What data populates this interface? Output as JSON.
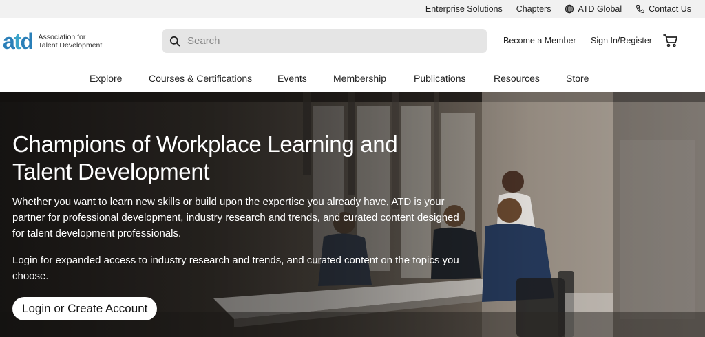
{
  "topbar": {
    "links": {
      "enterprise": "Enterprise Solutions",
      "chapters": "Chapters",
      "global": "ATD Global",
      "contact": "Contact Us"
    }
  },
  "header": {
    "logo": {
      "mark_a": "a",
      "mark_t": "t",
      "mark_d": "d",
      "line1": "Association for",
      "line2": "Talent Development"
    },
    "search": {
      "placeholder": "Search",
      "value": ""
    },
    "become_member": "Become a Member",
    "sign_in": "Sign In/Register"
  },
  "nav": {
    "items": [
      "Explore",
      "Courses & Certifications",
      "Events",
      "Membership",
      "Publications",
      "Resources",
      "Store"
    ]
  },
  "hero": {
    "title": "Champions of Workplace Learning and Talent Development",
    "paragraph1": "Whether you want to learn new skills or build upon the expertise you already have, ATD is your partner for professional development, industry research and trends, and curated content designed for talent development professionals.",
    "paragraph2": "Login for expanded access to industry research and trends, and curated content on the topics you choose.",
    "cta": "Login or Create Account"
  },
  "colors": {
    "brand_blue": "#2a7fb8",
    "brand_teal": "#3aa3c9",
    "topbar_bg": "#f1f1f1",
    "search_bg": "#e5e5e5"
  },
  "icons": {
    "globe": "globe-icon",
    "phone": "phone-icon",
    "search": "search-icon",
    "cart": "cart-icon"
  }
}
